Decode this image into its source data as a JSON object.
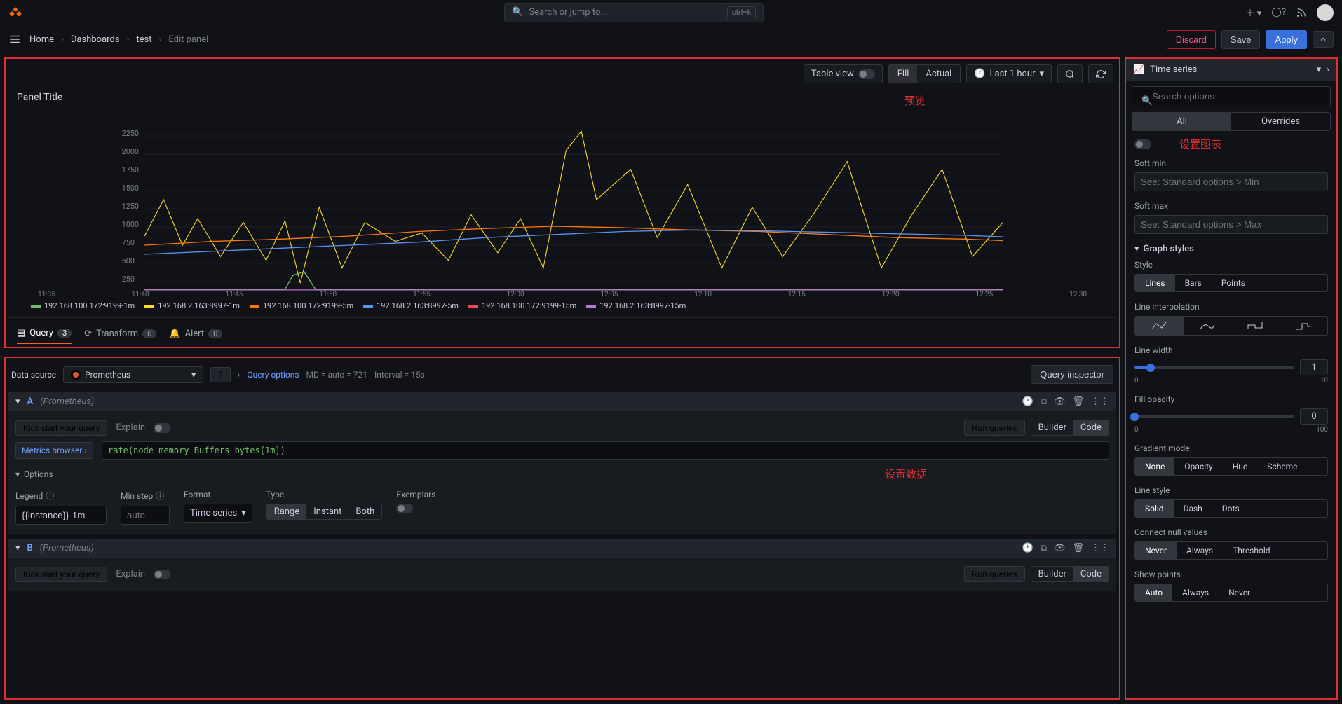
{
  "topbar": {
    "search_placeholder": "Search or jump to...",
    "search_shortcut": "ctrl+k"
  },
  "breadcrumbs": {
    "items": [
      "Home",
      "Dashboards",
      "test",
      "Edit panel"
    ],
    "actions": {
      "discard": "Discard",
      "save": "Save",
      "apply": "Apply"
    }
  },
  "preview": {
    "toolbar": {
      "table_view": "Table view",
      "fill": "Fill",
      "actual": "Actual",
      "time_range": "Last 1 hour"
    },
    "panel_title": "Panel Title",
    "annotation": "预览"
  },
  "chart_data": {
    "type": "line",
    "title": "Panel Title",
    "xlabel": "",
    "ylabel": "",
    "ylim": [
      0,
      2250
    ],
    "yticks": [
      250,
      500,
      750,
      1000,
      1250,
      1500,
      1750,
      2000,
      2250
    ],
    "x_categories": [
      "11:35",
      "11:40",
      "11:45",
      "11:50",
      "11:55",
      "12:00",
      "12:05",
      "12:10",
      "12:15",
      "12:20",
      "12:25",
      "12:30"
    ],
    "series": [
      {
        "name": "192.168.100.172:9199-1m",
        "color": "#73bf69",
        "values": [
          20,
          20,
          20,
          20,
          260,
          20,
          20,
          20,
          20,
          20,
          20,
          20
        ]
      },
      {
        "name": "192.168.2.163:8997-1m",
        "color": "#fade2a",
        "values": [
          850,
          1300,
          700,
          1050,
          600,
          950,
          500,
          1100,
          750,
          1000,
          680,
          2050,
          1350,
          650,
          1250,
          900,
          1100,
          800,
          650,
          1200,
          1300,
          750,
          1050,
          900,
          1350,
          700
        ]
      },
      {
        "name": "192.168.100.172:9199-5m",
        "color": "#ff780a",
        "values": [
          730,
          780,
          750,
          820,
          790,
          870,
          900,
          920,
          880,
          860,
          900,
          870,
          850,
          890,
          870,
          840,
          820,
          800,
          780,
          760,
          780,
          800,
          790,
          770
        ]
      },
      {
        "name": "192.168.2.163:8997-5m",
        "color": "#5794f2",
        "values": [
          620,
          650,
          700,
          680,
          720,
          750,
          780,
          800,
          820,
          850,
          860,
          870,
          880,
          870,
          860,
          850,
          840,
          830,
          820,
          810,
          800,
          790,
          780,
          770
        ]
      },
      {
        "name": "192.168.100.172:9199-15m",
        "color": "#f2495c",
        "values": [
          10,
          10,
          10,
          10,
          10,
          10,
          10,
          10,
          10,
          10,
          10,
          10
        ]
      },
      {
        "name": "192.168.2.163:8997-15m",
        "color": "#b877d9",
        "values": [
          10,
          10,
          10,
          10,
          10,
          10,
          10,
          10,
          10,
          10,
          10,
          10
        ]
      }
    ]
  },
  "tabs": {
    "query": {
      "label": "Query",
      "count": "3"
    },
    "transform": {
      "label": "Transform",
      "count": "0"
    },
    "alert": {
      "label": "Alert",
      "count": "0"
    }
  },
  "datasource": {
    "label": "Data source",
    "value": "Prometheus",
    "query_options": "Query options",
    "md": "MD = auto = 721",
    "interval": "Interval = 15s",
    "inspector": "Query inspector"
  },
  "queries": [
    {
      "letter": "A",
      "ds": "(Prometheus)",
      "kickstart": "Kick start your query",
      "explain": "Explain",
      "run": "Run queries",
      "builder": "Builder",
      "code": "Code",
      "metrics_browser": "Metrics browser",
      "expr": "rate(node_memory_Buffers_bytes[1m])",
      "options_label": "Options",
      "legend_label": "Legend",
      "legend_value": "{{instance}}-1m",
      "minstep_label": "Min step",
      "minstep_value": "auto",
      "format_label": "Format",
      "format_value": "Time series",
      "type_label": "Type",
      "type_range": "Range",
      "type_instant": "Instant",
      "type_both": "Both",
      "exemplars_label": "Exemplars",
      "annotation": "设置数据"
    },
    {
      "letter": "B",
      "ds": "(Prometheus)",
      "kickstart": "Kick start your query",
      "explain": "Explain",
      "run": "Run queries",
      "builder": "Builder",
      "code": "Code"
    }
  ],
  "sidebar": {
    "viz_type": "Time series",
    "search_placeholder": "Search options",
    "tab_all": "All",
    "tab_overrides": "Overrides",
    "annotation": "设置图表",
    "soft_min_label": "Soft min",
    "soft_min_ph": "See: Standard options > Min",
    "soft_max_label": "Soft max",
    "soft_max_ph": "See: Standard options > Max",
    "graph_styles": "Graph styles",
    "style_label": "Style",
    "style_opts": [
      "Lines",
      "Bars",
      "Points"
    ],
    "interp_label": "Line interpolation",
    "linewidth_label": "Line width",
    "linewidth_value": "1",
    "linewidth_range": [
      "0",
      "10"
    ],
    "fillop_label": "Fill opacity",
    "fillop_value": "0",
    "fillop_range": [
      "0",
      "100"
    ],
    "gradient_label": "Gradient mode",
    "gradient_opts": [
      "None",
      "Opacity",
      "Hue",
      "Scheme"
    ],
    "linestyle_label": "Line style",
    "linestyle_opts": [
      "Solid",
      "Dash",
      "Dots"
    ],
    "connect_label": "Connect null values",
    "connect_opts": [
      "Never",
      "Always",
      "Threshold"
    ],
    "showpoints_label": "Show points",
    "showpoints_opts": [
      "Auto",
      "Always",
      "Never"
    ]
  }
}
